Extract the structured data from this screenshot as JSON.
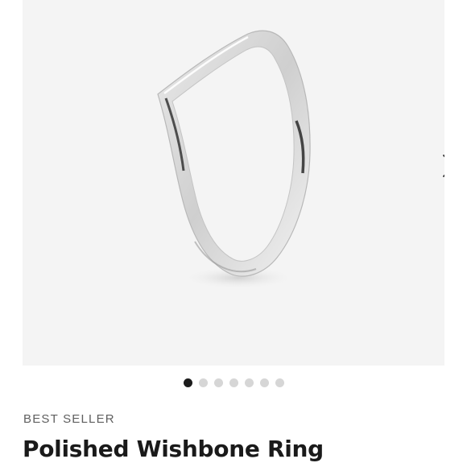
{
  "product": {
    "badge": "BEST SELLER",
    "title": "Polished Wishbone Ring"
  },
  "gallery": {
    "image_name": "polished-wishbone-ring",
    "next_icon": "chevron-right-icon",
    "dot_count": 7,
    "active_index": 0
  },
  "colors": {
    "image_background": "#f4f4f4",
    "dot_active": "#1c1c1c",
    "dot_inactive": "#d6d6d6",
    "title_text": "#1a1a1a",
    "badge_text": "#5f5f5f"
  }
}
